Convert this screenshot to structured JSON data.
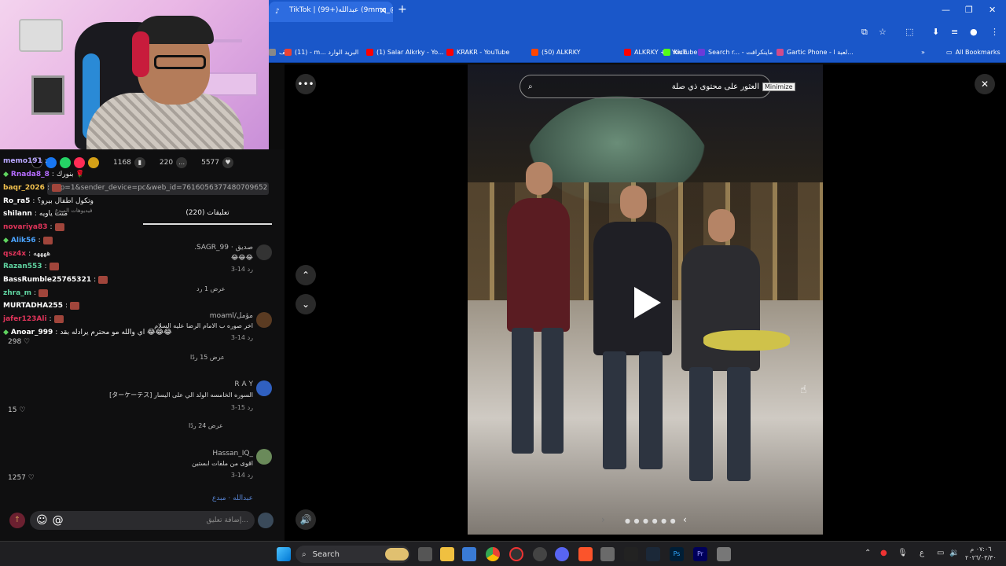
{
  "browser": {
    "tab_title": "TikTok | (99+)عبدالله (9mmq_@)",
    "new_tab": "+",
    "bookmarks": [
      {
        "label": "الف",
        "color": "#888"
      },
      {
        "label": "(11) - m... البريد الوارد",
        "color": "#ea4335"
      },
      {
        "label": "(1) Salar Alkrky - Yo...",
        "color": "#ff0000"
      },
      {
        "label": "KRAKR - YouTube",
        "color": "#ff0000"
      },
      {
        "label": "(50) ALKRKY",
        "color": "#ff4500"
      },
      {
        "label": "ALKRKY + - YouTube",
        "color": "#ff0000"
      },
      {
        "label": "Kick",
        "color": "#53fc18"
      },
      {
        "label": "Search r... - ماينكرافت",
        "color": "#6c3bd8"
      },
      {
        "label": "Gartic Phone - لعبة ا...",
        "color": "#d14b8a"
      }
    ],
    "all_bookmarks": "All Bookmarks"
  },
  "stream": {
    "stats": {
      "views": "1168",
      "comments": "220",
      "likes": "5577"
    },
    "url_fragment": "...p=1&sender_device=pc&web_id=7616056377480709652",
    "comments_tab": "(220) تعليقات",
    "videos_tab": "فيديوهات المبدع"
  },
  "chat": [
    {
      "name": "memo191",
      "text": "",
      "color": "#b9a7ff",
      "badge": false,
      "emote": false
    },
    {
      "name": "Rnada8_8",
      "text": "بنورك 🌹",
      "color": "#b56cff",
      "badge": true,
      "emote": false
    },
    {
      "name": "baqr_2026",
      "text": "",
      "color": "#f2c14e",
      "badge": false,
      "emote": true
    },
    {
      "name": "Ro_ra5",
      "text": "وتكول اطفال بيرو؟",
      "color": "#ffffff",
      "badge": false,
      "emote": false
    },
    {
      "name": "shilann",
      "text": "متت ياويه",
      "color": "#ffffff",
      "badge": false,
      "emote": false
    },
    {
      "name": "novariya83",
      "text": "",
      "color": "#e0345a",
      "badge": false,
      "emote": true
    },
    {
      "name": "Alik56",
      "text": "",
      "color": "#4aa3ff",
      "badge": true,
      "emote": true
    },
    {
      "name": "qsz4x",
      "text": "ههههه",
      "color": "#e0345a",
      "badge": false,
      "emote": false
    },
    {
      "name": "Razan553",
      "text": "",
      "color": "#5fd3a0",
      "badge": false,
      "emote": true
    },
    {
      "name": "BassRumble25765321",
      "text": "",
      "color": "#ffffff",
      "badge": false,
      "emote": true
    },
    {
      "name": "zhra_m",
      "text": "",
      "color": "#5fd3a0",
      "badge": false,
      "emote": true
    },
    {
      "name": "MURTADHA255",
      "text": "",
      "color": "#ffffff",
      "badge": false,
      "emote": true
    },
    {
      "name": "jafer123Ali",
      "text": "",
      "color": "#e0345a",
      "badge": false,
      "emote": true
    },
    {
      "name": "Anoar_999",
      "text": "اي والله مو محترم يرادله بقد 😂😂😂",
      "color": "#ffffff",
      "badge": true,
      "emote": false
    }
  ],
  "comments": [
    {
      "name": ".SAGR_99 · صديق",
      "text": "😂😂😂",
      "meta": "3-14   رد",
      "replies": "عرض 1 رد",
      "likes": "3"
    },
    {
      "name": "moaml/مؤمل",
      "text": "اخر صوره ب الامام الرضا عليه السلام",
      "meta": "3-14   رد",
      "replies": "عرض 15 ردًا",
      "likes": "298"
    },
    {
      "name": "R A Y",
      "text": "[ターケーテス] السوره الخامسه الولد الي على اليسار",
      "meta": "3-15   رد",
      "replies": "عرض 24 ردًا",
      "likes": "15"
    },
    {
      "name": "Hassan_IQ_",
      "text": "اقوى من ملفات ابستين",
      "meta": "3-14   رد",
      "replies": "",
      "likes": "1257"
    },
    {
      "name": "عبدالله · مبدع",
      "text": "",
      "meta": "",
      "replies": "",
      "likes": ""
    }
  ],
  "input": {
    "placeholder": "إضافة تعليق..."
  },
  "viewer": {
    "search_text": "العثور على محتوى ذي صلة",
    "tooltip": "Minimize",
    "more": "•••",
    "close": "✕"
  },
  "taskbar": {
    "search_label": "Search",
    "clock_time": "٠٧:٠٦ م",
    "clock_date": "٢٠٢٦/٠٣/٣٠",
    "lang": "ع"
  }
}
